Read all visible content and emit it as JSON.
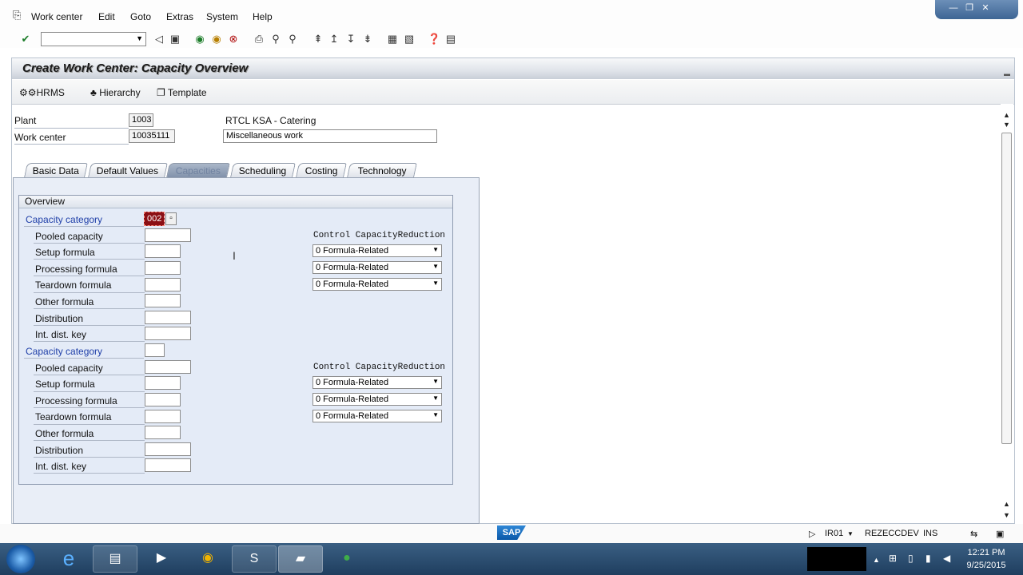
{
  "menubar": {
    "items": [
      {
        "label": "Work center"
      },
      {
        "label": "Edit"
      },
      {
        "label": "Goto"
      },
      {
        "label": "Extras"
      },
      {
        "label": "System"
      },
      {
        "label": "Help"
      }
    ]
  },
  "window_controls": {
    "minimize": "—",
    "restore": "❐",
    "close": "✕"
  },
  "toolbar": {
    "command_field_value": ""
  },
  "screen": {
    "title": "Create Work Center: Capacity Overview"
  },
  "app_toolbar": {
    "hrms_label": "HRMS",
    "hierarchy_label": "Hierarchy",
    "template_label": "Template"
  },
  "header": {
    "plant_label": "Plant",
    "plant_value": "1003",
    "plant_desc": "RTCL KSA - Catering",
    "workcenter_label": "Work center",
    "workcenter_value": "10035111",
    "workcenter_desc": "Miscellaneous work"
  },
  "tabs": [
    {
      "label": "Basic Data",
      "active": false
    },
    {
      "label": "Default Values",
      "active": false
    },
    {
      "label": "Capacities",
      "active": true
    },
    {
      "label": "Scheduling",
      "active": false
    },
    {
      "label": "Costing",
      "active": false
    },
    {
      "label": "Technology",
      "active": false
    }
  ],
  "overview": {
    "group_title": "Overview",
    "control_header": "Control CapacityReduction",
    "section1": {
      "category_label": "Capacity category",
      "category_value": "002",
      "pooled_label": "Pooled capacity",
      "setup_label": "Setup formula",
      "processing_label": "Processing formula",
      "teardown_label": "Teardown formula",
      "other_label": "Other formula",
      "distribution_label": "Distribution",
      "intdist_label": "Int. dist. key",
      "setup_reduction": "0 Formula-Related",
      "processing_reduction": "0 Formula-Related",
      "teardown_reduction": "0 Formula-Related"
    },
    "section2": {
      "category_label": "Capacity category",
      "category_value": "",
      "pooled_label": "Pooled capacity",
      "setup_label": "Setup formula",
      "processing_label": "Processing formula",
      "teardown_label": "Teardown formula",
      "other_label": "Other formula",
      "distribution_label": "Distribution",
      "intdist_label": "Int. dist. key",
      "setup_reduction": "0 Formula-Related",
      "processing_reduction": "0 Formula-Related",
      "teardown_reduction": "0 Formula-Related"
    }
  },
  "statusbar": {
    "logo": "SAP",
    "system": "IR01",
    "server": "REZECCDEV",
    "mode": "INS"
  },
  "taskbar": {
    "time": "12:21 PM",
    "date": "9/25/2015"
  }
}
